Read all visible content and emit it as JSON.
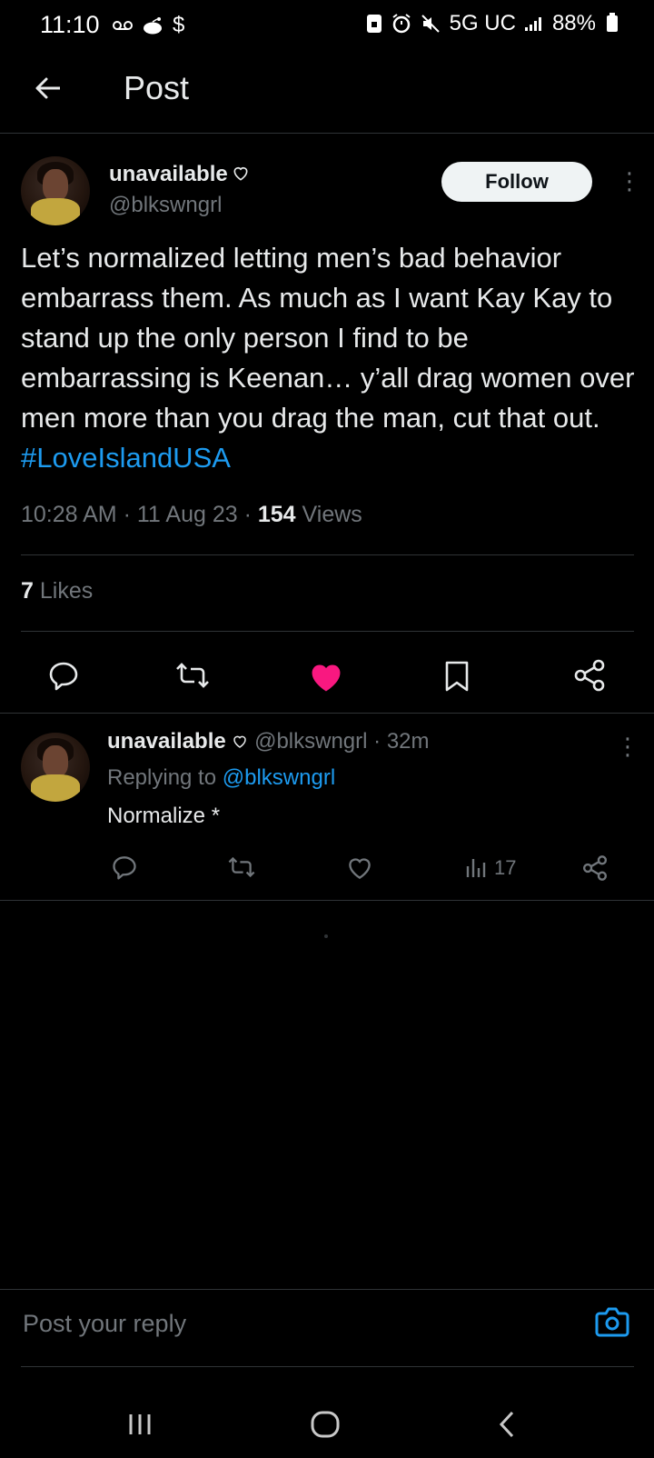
{
  "status_bar": {
    "time": "11:10",
    "left_icons": [
      "voicemail-icon",
      "reddit-icon",
      "dollar-icon"
    ],
    "dollar": "$",
    "network": "5G UC",
    "battery": "88%"
  },
  "header": {
    "title": "Post"
  },
  "post": {
    "author_name": "unavailable",
    "author_handle": "@blkswngrl",
    "follow_label": "Follow",
    "text": "Let’s normalized letting men’s bad behavior embarrass them. As much as I want Kay Kay to stand up the only person I find to be embarrassing is Keenan… y’all drag women over men more than you drag the man, cut that out. ",
    "hashtag": "#LoveIslandUSA",
    "time": "10:28 AM",
    "date": "11 Aug 23",
    "views": "154",
    "views_label": "Views",
    "likes": "7",
    "likes_label": "Likes",
    "liked": true,
    "like_color": "#f91880"
  },
  "reply": {
    "author_name": "unavailable",
    "author_handle": "@blkswngrl",
    "age": "32m",
    "replying_to_label": "Replying to",
    "replying_to_handle": "@blkswngrl",
    "text": "Normalize *",
    "views": "17"
  },
  "composer": {
    "placeholder": "Post your reply"
  },
  "colors": {
    "accent": "#1d9bf0",
    "background": "#000000",
    "muted": "#71767b"
  }
}
